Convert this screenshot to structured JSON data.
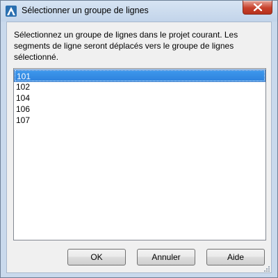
{
  "window": {
    "title": "Sélectionner un groupe de lignes",
    "app_icon": "autocad-civil-logo-icon",
    "close_icon": "close-icon"
  },
  "dialog": {
    "description": "Sélectionnez un groupe de lignes dans le projet courant. Les segments de ligne seront déplacés vers le groupe de lignes sélectionné.",
    "list_items": [
      "101",
      "102",
      "104",
      "106",
      "107"
    ],
    "selected_item": "101"
  },
  "buttons": {
    "ok": "OK",
    "cancel": "Annuler",
    "help": "Aide"
  },
  "colors": {
    "selection": "#3d97ec",
    "close_button": "#c7402b",
    "window_frame": "#c9d9ec"
  }
}
